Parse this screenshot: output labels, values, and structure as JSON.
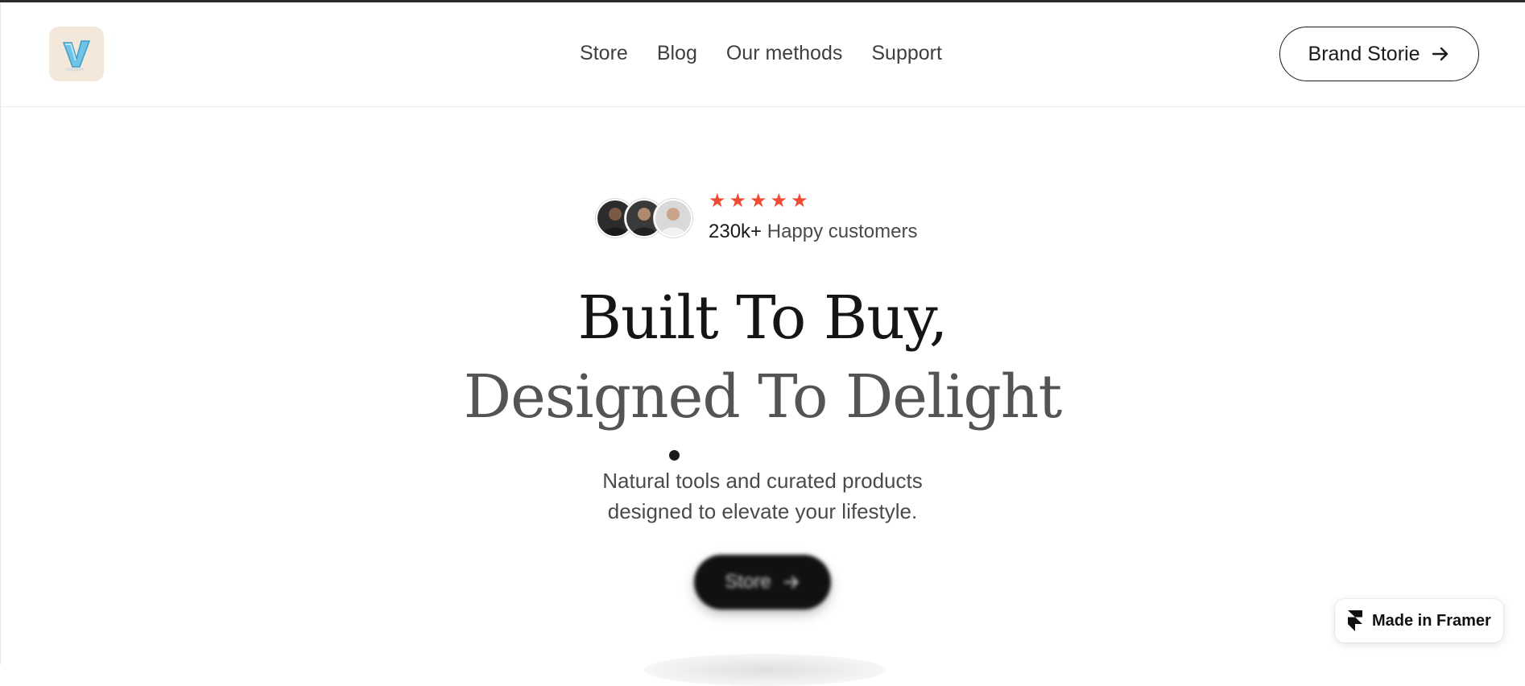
{
  "nav": {
    "logo_icon": "v-logo-icon",
    "links": [
      "Store",
      "Blog",
      "Our methods",
      "Support"
    ],
    "cta_label": "Brand Storie",
    "cta_icon": "arrow-right-icon"
  },
  "hero": {
    "rating_stars": 5,
    "customer_count": "230k+",
    "customer_label": "Happy customers",
    "headline_line1": "Built To Buy,",
    "headline_line2": "Designed To Delight",
    "subtitle_line1": "Natural tools and curated products",
    "subtitle_line2": "designed to elevate your lifestyle.",
    "cta_label": "Store",
    "cta_icon": "arrow-right-icon"
  },
  "badge": {
    "label": "Made in Framer",
    "icon": "framer-logo-icon"
  },
  "colors": {
    "star": "#f04a33",
    "logo_bg": "#f3e8da",
    "logo_letter": "#6ec3e6",
    "cta_dark": "#111111"
  }
}
